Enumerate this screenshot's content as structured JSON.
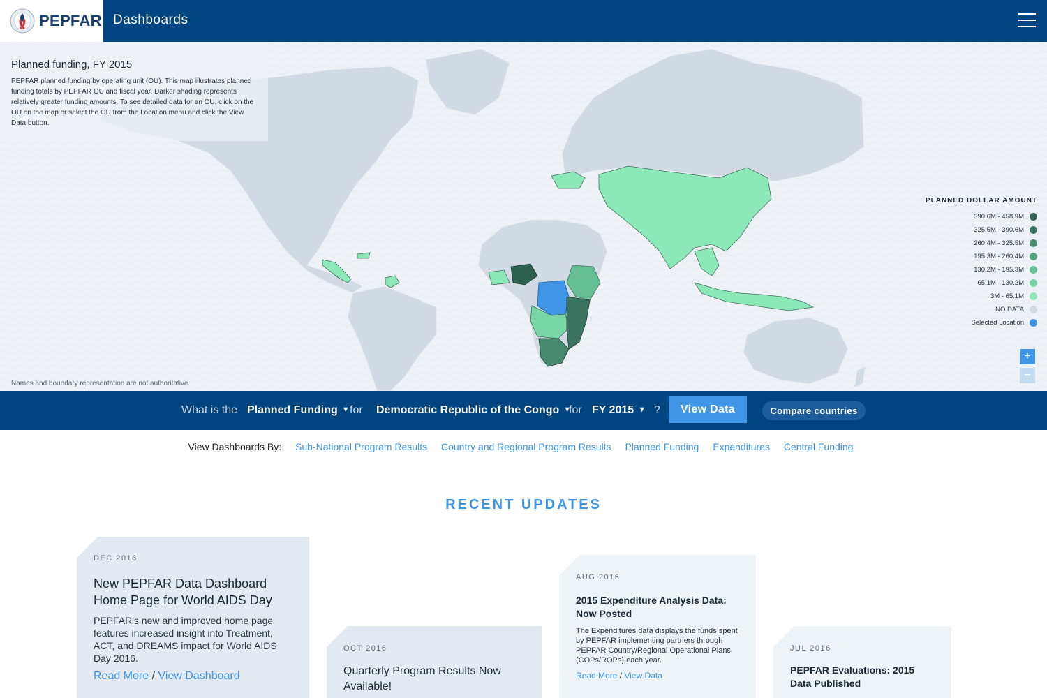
{
  "header": {
    "brand_name": "PEPFAR",
    "section_title": "Dashboards",
    "logo_icon": "pepfar-seal-icon",
    "menu_icon": "hamburger-menu-icon",
    "bg_color": "#004480"
  },
  "map": {
    "title": "Planned funding, FY 2015",
    "description": "PEPFAR planned funding by operating unit (OU). This map illustrates planned funding totals by PEPFAR OU and fiscal year. Darker shading represents relatively greater funding amounts. To see detailed data for an OU, click on the OU on the map or select the OU from the Location menu and click the View Data button.",
    "footnote": "Names and boundary representation are not authoritative.",
    "legend": {
      "title": "PLANNED DOLLAR AMOUNT",
      "items": [
        {
          "label": "390.6M - 458.9M",
          "color": "#2e5f4f"
        },
        {
          "label": "325.5M - 390.6M",
          "color": "#3a7460"
        },
        {
          "label": "260.4M - 325.5M",
          "color": "#468a70"
        },
        {
          "label": "195.3M - 260.4M",
          "color": "#56a683"
        },
        {
          "label": "130.2M - 195.3M",
          "color": "#66bf94"
        },
        {
          "label": "65.1M - 130.2M",
          "color": "#78d6a6"
        },
        {
          "label": "3M - 65.1M",
          "color": "#8ce8b8"
        },
        {
          "label": "NO DATA",
          "color": "#d2dbe4"
        },
        {
          "label": "Selected Location",
          "color": "#3f95e6"
        }
      ]
    },
    "zoom_in": "+",
    "zoom_out": "−"
  },
  "query": {
    "what_is_the": "What is the",
    "metric": "Planned Funding",
    "for1": "for",
    "location": "Democratic Republic of the Congo",
    "for2": "for",
    "year": "FY 2015",
    "question": "?",
    "view_data": "View Data",
    "compare": "Compare countries"
  },
  "dashboards": {
    "label": "View Dashboards By:",
    "links": [
      "Sub-National Program Results",
      "Country and Regional Program Results",
      "Planned Funding",
      "Expenditures",
      "Central Funding"
    ]
  },
  "recent": {
    "title": "RECENT UPDATES",
    "cards": [
      {
        "date": "DEC 2016",
        "title": "New PEPFAR Data Dashboard Home Page for World AIDS Day",
        "body": "PEPFAR's new and improved home page features increased insight into Treatment, ACT, and DREAMS impact for World AIDS Day 2016.",
        "link1": "Read More",
        "sep": "/",
        "link2": "View Dashboard"
      },
      {
        "date": "OCT 2016",
        "title": "Quarterly Program Results Now Available!"
      },
      {
        "date": "AUG 2016",
        "title": "2015 Expenditure Analysis Data: Now Posted",
        "body": "The Expenditures data displays the funds spent by PEPFAR implementing partners through PEPFAR Country/Regional Operational Plans (COPs/ROPs) each year.",
        "link1": "Read More",
        "sep": "/",
        "link2": "View Data"
      },
      {
        "date": "JUL 2016",
        "title": "PEPFAR Evaluations: 2015 Data Published"
      }
    ]
  }
}
